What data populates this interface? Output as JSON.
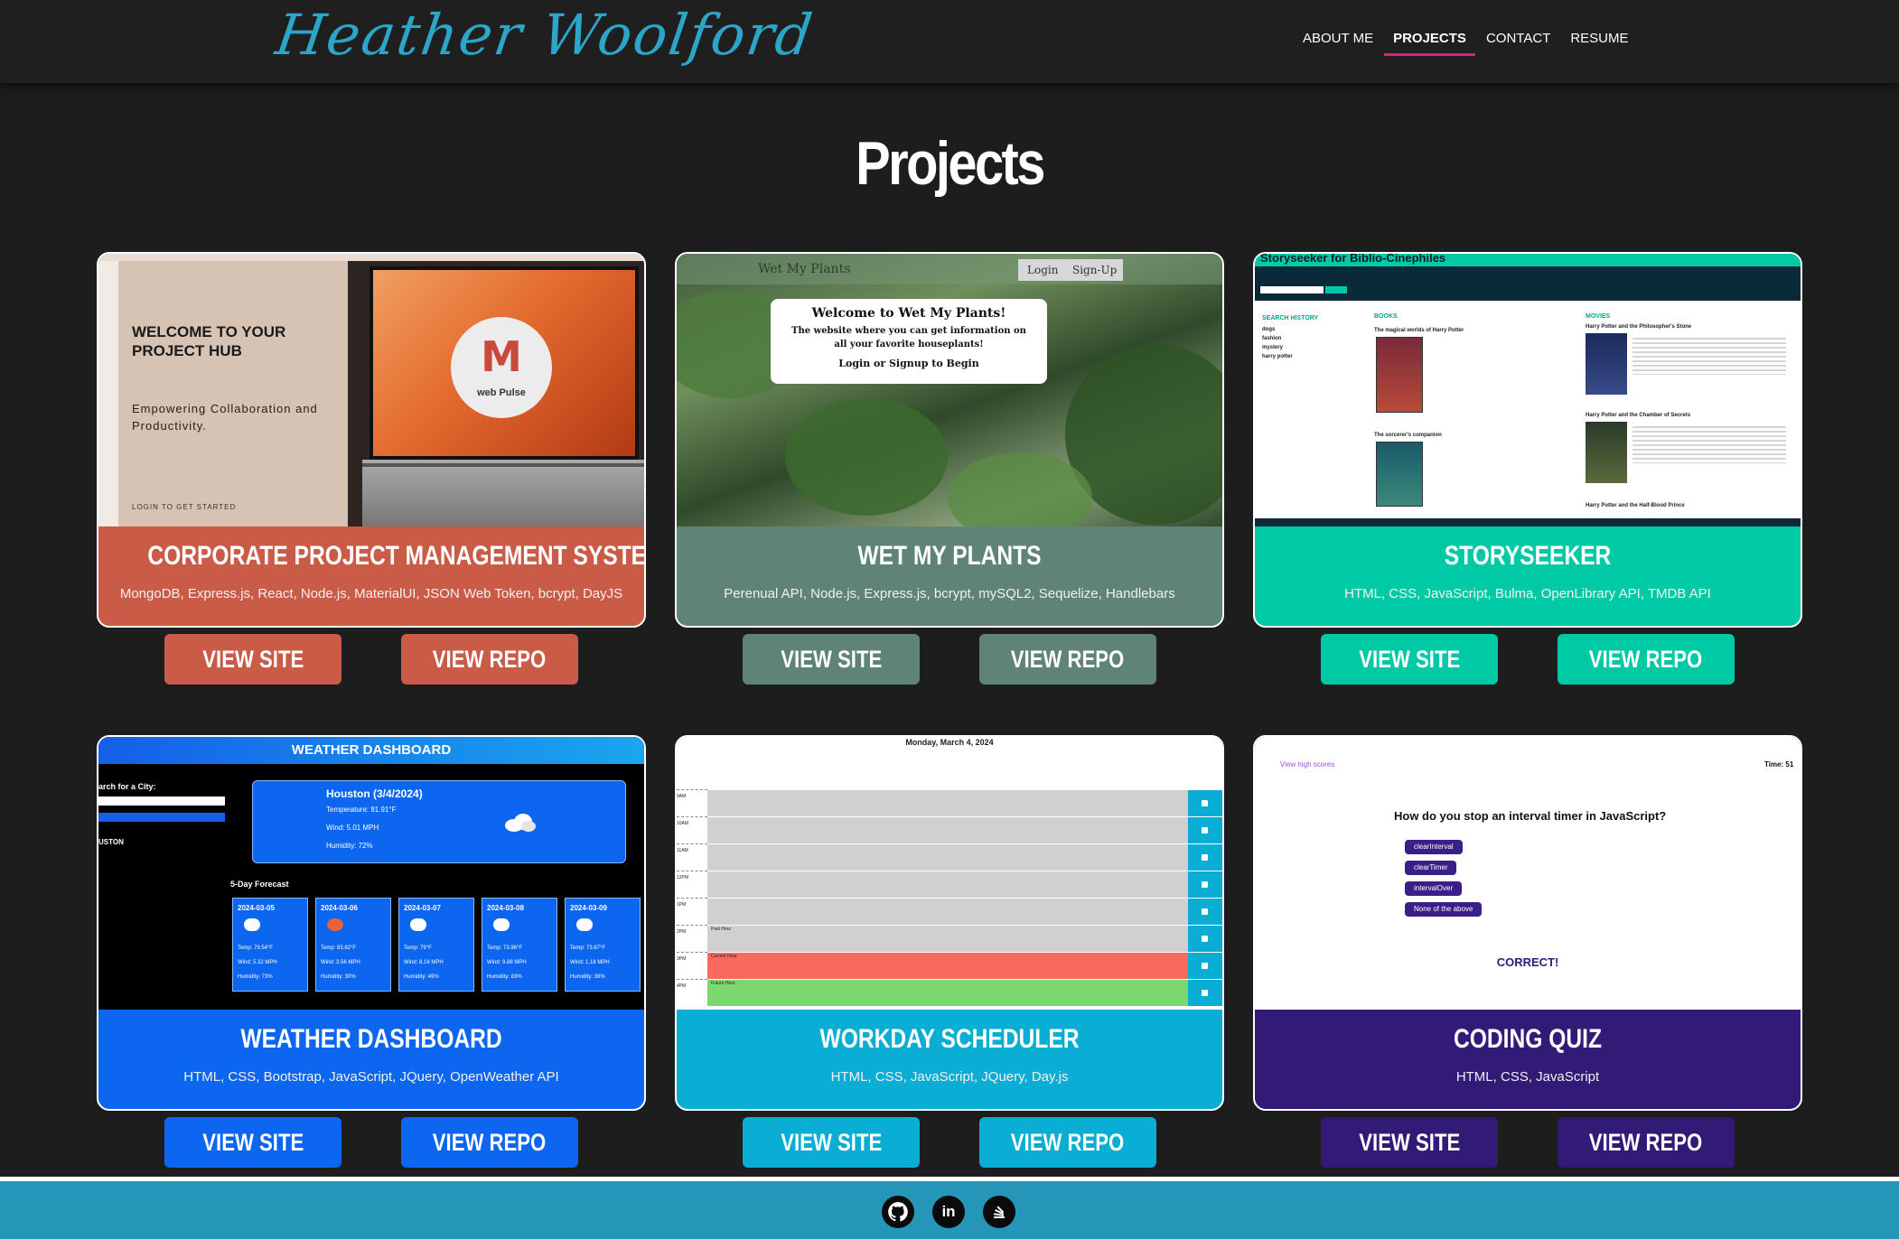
{
  "header": {
    "logo": "Heather Woolford",
    "nav": [
      {
        "label": "ABOUT ME"
      },
      {
        "label": "PROJECTS"
      },
      {
        "label": "CONTACT"
      },
      {
        "label": "RESUME"
      }
    ]
  },
  "page_title": "Projects",
  "projects": [
    {
      "title": "CORPORATE PROJECT MANAGEMENT SYSTEM",
      "tech": "MongoDB, Express.js, React, Node.js, MaterialUI, JSON Web Token, bcrypt, DayJS",
      "color": "#c95b47",
      "site_label": "VIEW SITE",
      "repo_label": "VIEW REPO"
    },
    {
      "title": "WET MY PLANTS",
      "tech": "Perenual API, Node.js, Express.js, bcrypt, mySQL2, Sequelize, Handlebars",
      "color": "#5f8279",
      "site_label": "VIEW SITE",
      "repo_label": "VIEW REPO"
    },
    {
      "title": "STORYSEEKER",
      "tech": "HTML, CSS, JavaScript, Bulma, OpenLibrary API, TMDB API",
      "color": "#00c9a5",
      "site_label": "VIEW SITE",
      "repo_label": "VIEW REPO"
    },
    {
      "title": "WEATHER DASHBOARD",
      "tech": "HTML, CSS, Bootstrap, JavaScript, JQuery, OpenWeather API",
      "color": "#0d66ef",
      "site_label": "VIEW SITE",
      "repo_label": "VIEW REPO"
    },
    {
      "title": "WORKDAY SCHEDULER",
      "tech": "HTML, CSS, JavaScript, JQuery, Day.js",
      "color": "#0aadd3",
      "site_label": "VIEW SITE",
      "repo_label": "VIEW REPO"
    },
    {
      "title": "CODING QUIZ",
      "tech": "HTML, CSS, JavaScript",
      "color": "#311b77",
      "site_label": "VIEW SITE",
      "repo_label": "VIEW REPO"
    }
  ],
  "thumbs": {
    "pm": {
      "heading": "WELCOME TO YOUR PROJECT HUB",
      "sub": "Empowering Collaboration and Productivity.",
      "login": "LOGIN TO GET STARTED",
      "brand": "web Pulse"
    },
    "plants": {
      "brand": "Wet My Plants",
      "login": "Login",
      "signup": "Sign-Up",
      "welcome": "Welcome to Wet My Plants!",
      "desc": "The website where you can get information on all your favorite houseplants!",
      "cta": "Login or Signup to Begin"
    },
    "story": {
      "title": "Storyseeker for Biblio-Cinephiles",
      "search_history": "SEARCH HISTORY",
      "history": [
        "dogs",
        "fashion",
        "mystery",
        "harry potter"
      ],
      "books": "BOOKS",
      "movies": "MOVIES",
      "book1": "The magical worlds of Harry Potter",
      "book2": "The sorcerer's companion",
      "movie1": "Harry Potter and the Philosopher's Stone",
      "movie2": "Harry Potter and the Chamber of Secrets",
      "movie3": "Harry Potter and the Half-Blood Prince"
    },
    "weather": {
      "title": "WEATHER DASHBOARD",
      "search": "arch for a City:",
      "city_btn": "USTON",
      "city": "Houston (3/4/2024)",
      "temp": "Temperature: 81.91°F",
      "wind": "Wind: 5.01 MPH",
      "humidity": "Humidity: 72%",
      "forecast": "5-Day Forecast",
      "days": [
        {
          "date": "2024-03-05",
          "temp": "Temp: 79.54°F",
          "wind": "Wind: 5.32 MPH",
          "hum": "Humidity: 73%"
        },
        {
          "date": "2024-03-06",
          "temp": "Temp: 83.82°F",
          "wind": "Wind: 3.56 MPH",
          "hum": "Humidity: 30%"
        },
        {
          "date": "2024-03-07",
          "temp": "Temp: 79°F",
          "wind": "Wind: 8.16 MPH",
          "hum": "Humidity: 49%"
        },
        {
          "date": "2024-03-08",
          "temp": "Temp: 73.96°F",
          "wind": "Wind: 9.88 MPH",
          "hum": "Humidity: 83%"
        },
        {
          "date": "2024-03-09",
          "temp": "Temp: 73.67°F",
          "wind": "Wind: 1.18 MPH",
          "hum": "Humidity: 36%"
        }
      ]
    },
    "scheduler": {
      "date": "Monday, March 4, 2024",
      "hours": [
        "9AM",
        "10AM",
        "11AM",
        "12PM",
        "1PM",
        "2PM",
        "3PM",
        "4PM"
      ],
      "past_note": "Past Hour",
      "current_note": "Current Hour",
      "future_note": "Future Hour"
    },
    "quiz": {
      "high_scores": "View high scores",
      "time": "Time: 51",
      "question": "How do you stop an interval timer in JavaScript?",
      "answers": [
        "clearInterval",
        "clearTimer",
        "intervalOver",
        "None of the above"
      ],
      "result": "CORRECT!"
    }
  },
  "footer": {
    "icons": [
      "github-icon",
      "linkedin-icon",
      "stackoverflow-icon"
    ]
  }
}
